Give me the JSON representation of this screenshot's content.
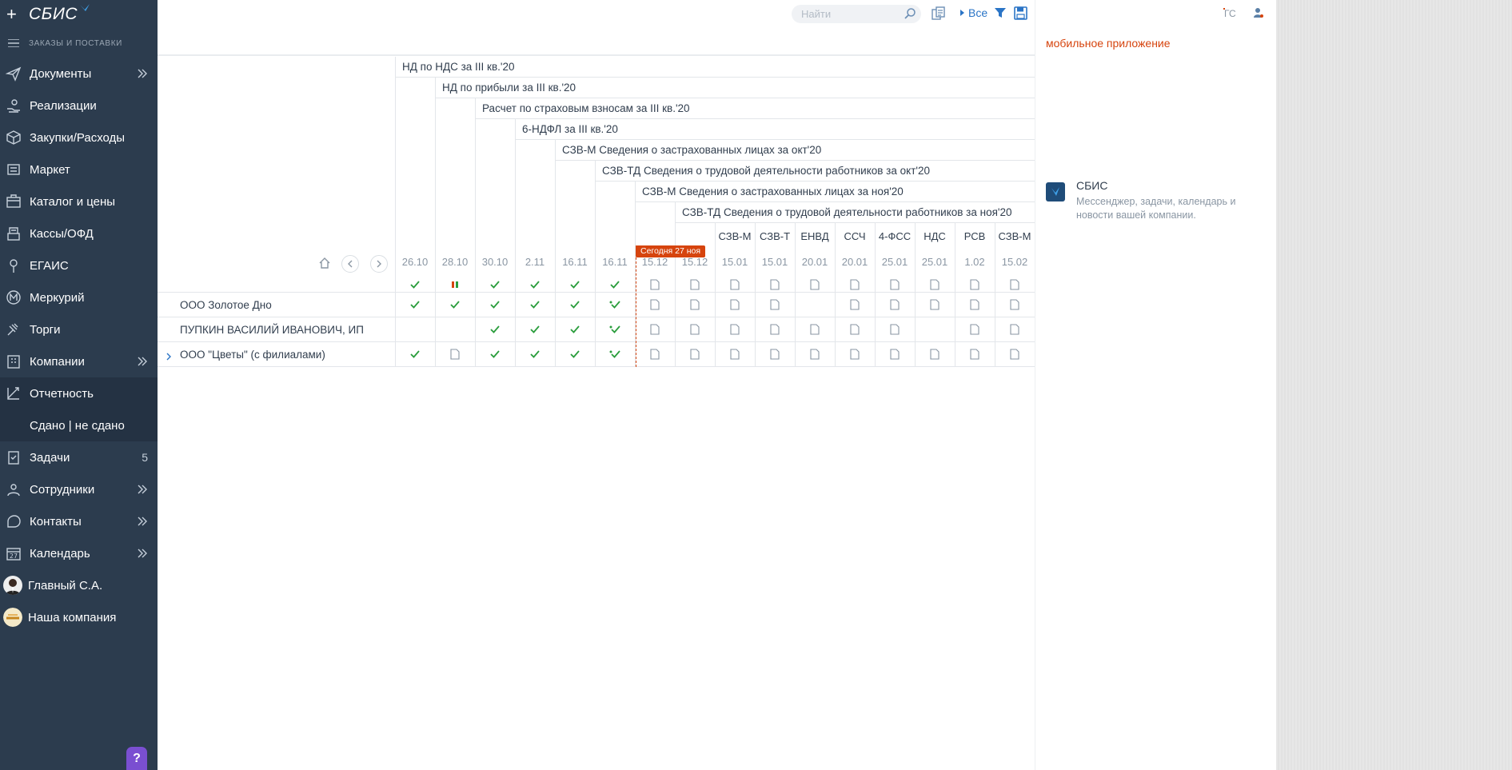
{
  "sidebar": {
    "logo": "СБИС",
    "section": "ЗАКАЗЫ И ПОСТАВКИ",
    "items": [
      {
        "label": "Документы",
        "arrow": true
      },
      {
        "label": "Реализации"
      },
      {
        "label": "Закупки/Расходы"
      },
      {
        "label": "Маркет"
      },
      {
        "label": "Каталог и цены"
      },
      {
        "label": "Кассы/ОФД"
      },
      {
        "label": "ЕГАИС"
      },
      {
        "label": "Меркурий"
      },
      {
        "label": "Торги"
      },
      {
        "label": "Компании",
        "arrow": true
      },
      {
        "label": "Отчетность"
      },
      {
        "label": "Задачи",
        "count": "5"
      },
      {
        "label": "Сотрудники",
        "arrow": true
      },
      {
        "label": "Контакты",
        "arrow": true
      },
      {
        "label": "Календарь",
        "arrow": true
      },
      {
        "label": "Главный С.А."
      },
      {
        "label": "Наша компания"
      }
    ],
    "submenu_active": "Сдано | не сдано",
    "calendar_day": "27",
    "help": "?"
  },
  "toolbar": {
    "search_placeholder": "Найти",
    "filter_all": "Все"
  },
  "reports": [
    "НД по НДС за III кв.'20",
    "НД по прибыли за III кв.'20",
    "Расчет по страховым взносам за III кв.'20",
    "6-НДФЛ за III кв.'20",
    "СЗВ-М Сведения о застрахованных лицах за окт'20",
    "СЗВ-ТД Сведения о трудовой деятельности работников за окт'20",
    "СЗВ-М Сведения о застрахованных лицах за ноя'20",
    "СЗВ-ТД Сведения о трудовой деятельности работников за ноя'20"
  ],
  "abbreviations": [
    "СЗВ-М",
    "СЗВ-Т",
    "ЕНВД",
    "ССЧ",
    "4-ФСС",
    "НДС",
    "РСВ",
    "СЗВ-М"
  ],
  "dates": [
    "26.10",
    "28.10",
    "30.10",
    "2.11",
    "16.11",
    "16.11",
    "15.12",
    "15.12",
    "15.01",
    "15.01",
    "20.01",
    "20.01",
    "25.01",
    "25.01",
    "1.02",
    "15.02"
  ],
  "today_label": "Сегодня 27 ноя",
  "header_status": [
    "check",
    "pause",
    "check",
    "check",
    "check",
    "check",
    "doc",
    "doc",
    "doc",
    "doc",
    "doc",
    "doc",
    "doc",
    "doc",
    "doc",
    "doc"
  ],
  "rows": [
    {
      "name": "ООО Золотое Дно",
      "expandable": false,
      "cells": [
        "check",
        "check",
        "check",
        "check",
        "check",
        "check-sent",
        "doc",
        "doc",
        "doc",
        "doc",
        "",
        "doc",
        "doc",
        "doc",
        "doc",
        "doc"
      ]
    },
    {
      "name": "ПУПКИН ВАСИЛИЙ ИВАНОВИЧ, ИП",
      "expandable": false,
      "cells": [
        "",
        "",
        "check",
        "check",
        "check",
        "check-sent",
        "doc",
        "doc",
        "doc",
        "doc",
        "doc",
        "doc",
        "doc",
        "",
        "doc",
        "doc"
      ]
    },
    {
      "name": "ООО \"Цветы\" (с филиалами)",
      "expandable": true,
      "cells": [
        "check",
        "doc",
        "check",
        "check",
        "check",
        "check-sent",
        "doc",
        "doc",
        "doc",
        "doc",
        "doc",
        "doc",
        "doc",
        "doc",
        "doc",
        "doc"
      ]
    }
  ],
  "right_panel": {
    "initials": "ГС",
    "mobile_link": "мобильное приложение",
    "card_title": "СБИС",
    "card_desc": "Мессенджер, задачи, календарь и новости вашей компании."
  },
  "colors": {
    "sidebar_bg": "#2c3c4e",
    "accent_orange": "#d6440e",
    "check_green": "#2a9d3c",
    "link_blue": "#2a74c6"
  }
}
